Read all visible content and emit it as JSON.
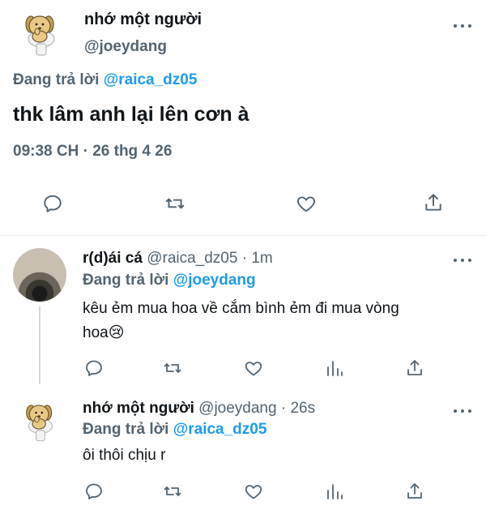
{
  "main_tweet": {
    "display_name": "nhớ một người",
    "handle": "@joeydang",
    "replying_prefix": "Đang trả lời",
    "replying_to": "@raica_dz05",
    "text": "thk lâm anh lại lên cơn à",
    "meta": "09:38 CH · 26 thg 4 26"
  },
  "reply1": {
    "display_name": "r(d)ái cá",
    "handle": "@raica_dz05",
    "time": "· 1m",
    "replying_prefix": "Đang trả lời",
    "replying_to": "@joeydang",
    "text_line1": "kêu ẻm mua hoa về cắm bình ẻm đi mua vòng",
    "text_line2": "hoa😢"
  },
  "reply2": {
    "display_name": "nhớ một người",
    "handle": "@joeydang",
    "time": "· 26s",
    "replying_prefix": "Đang trả lời",
    "replying_to": "@raica_dz05",
    "text": "ôi thôi chịu r"
  },
  "icons": {
    "reply": "reply-icon",
    "retweet": "retweet-icon",
    "like": "heart-icon",
    "share": "share-icon",
    "stats": "analytics-icon",
    "more": "more-icon"
  },
  "colors": {
    "accent": "#1d9bf0",
    "text": "#0f1419",
    "muted": "#536471"
  }
}
